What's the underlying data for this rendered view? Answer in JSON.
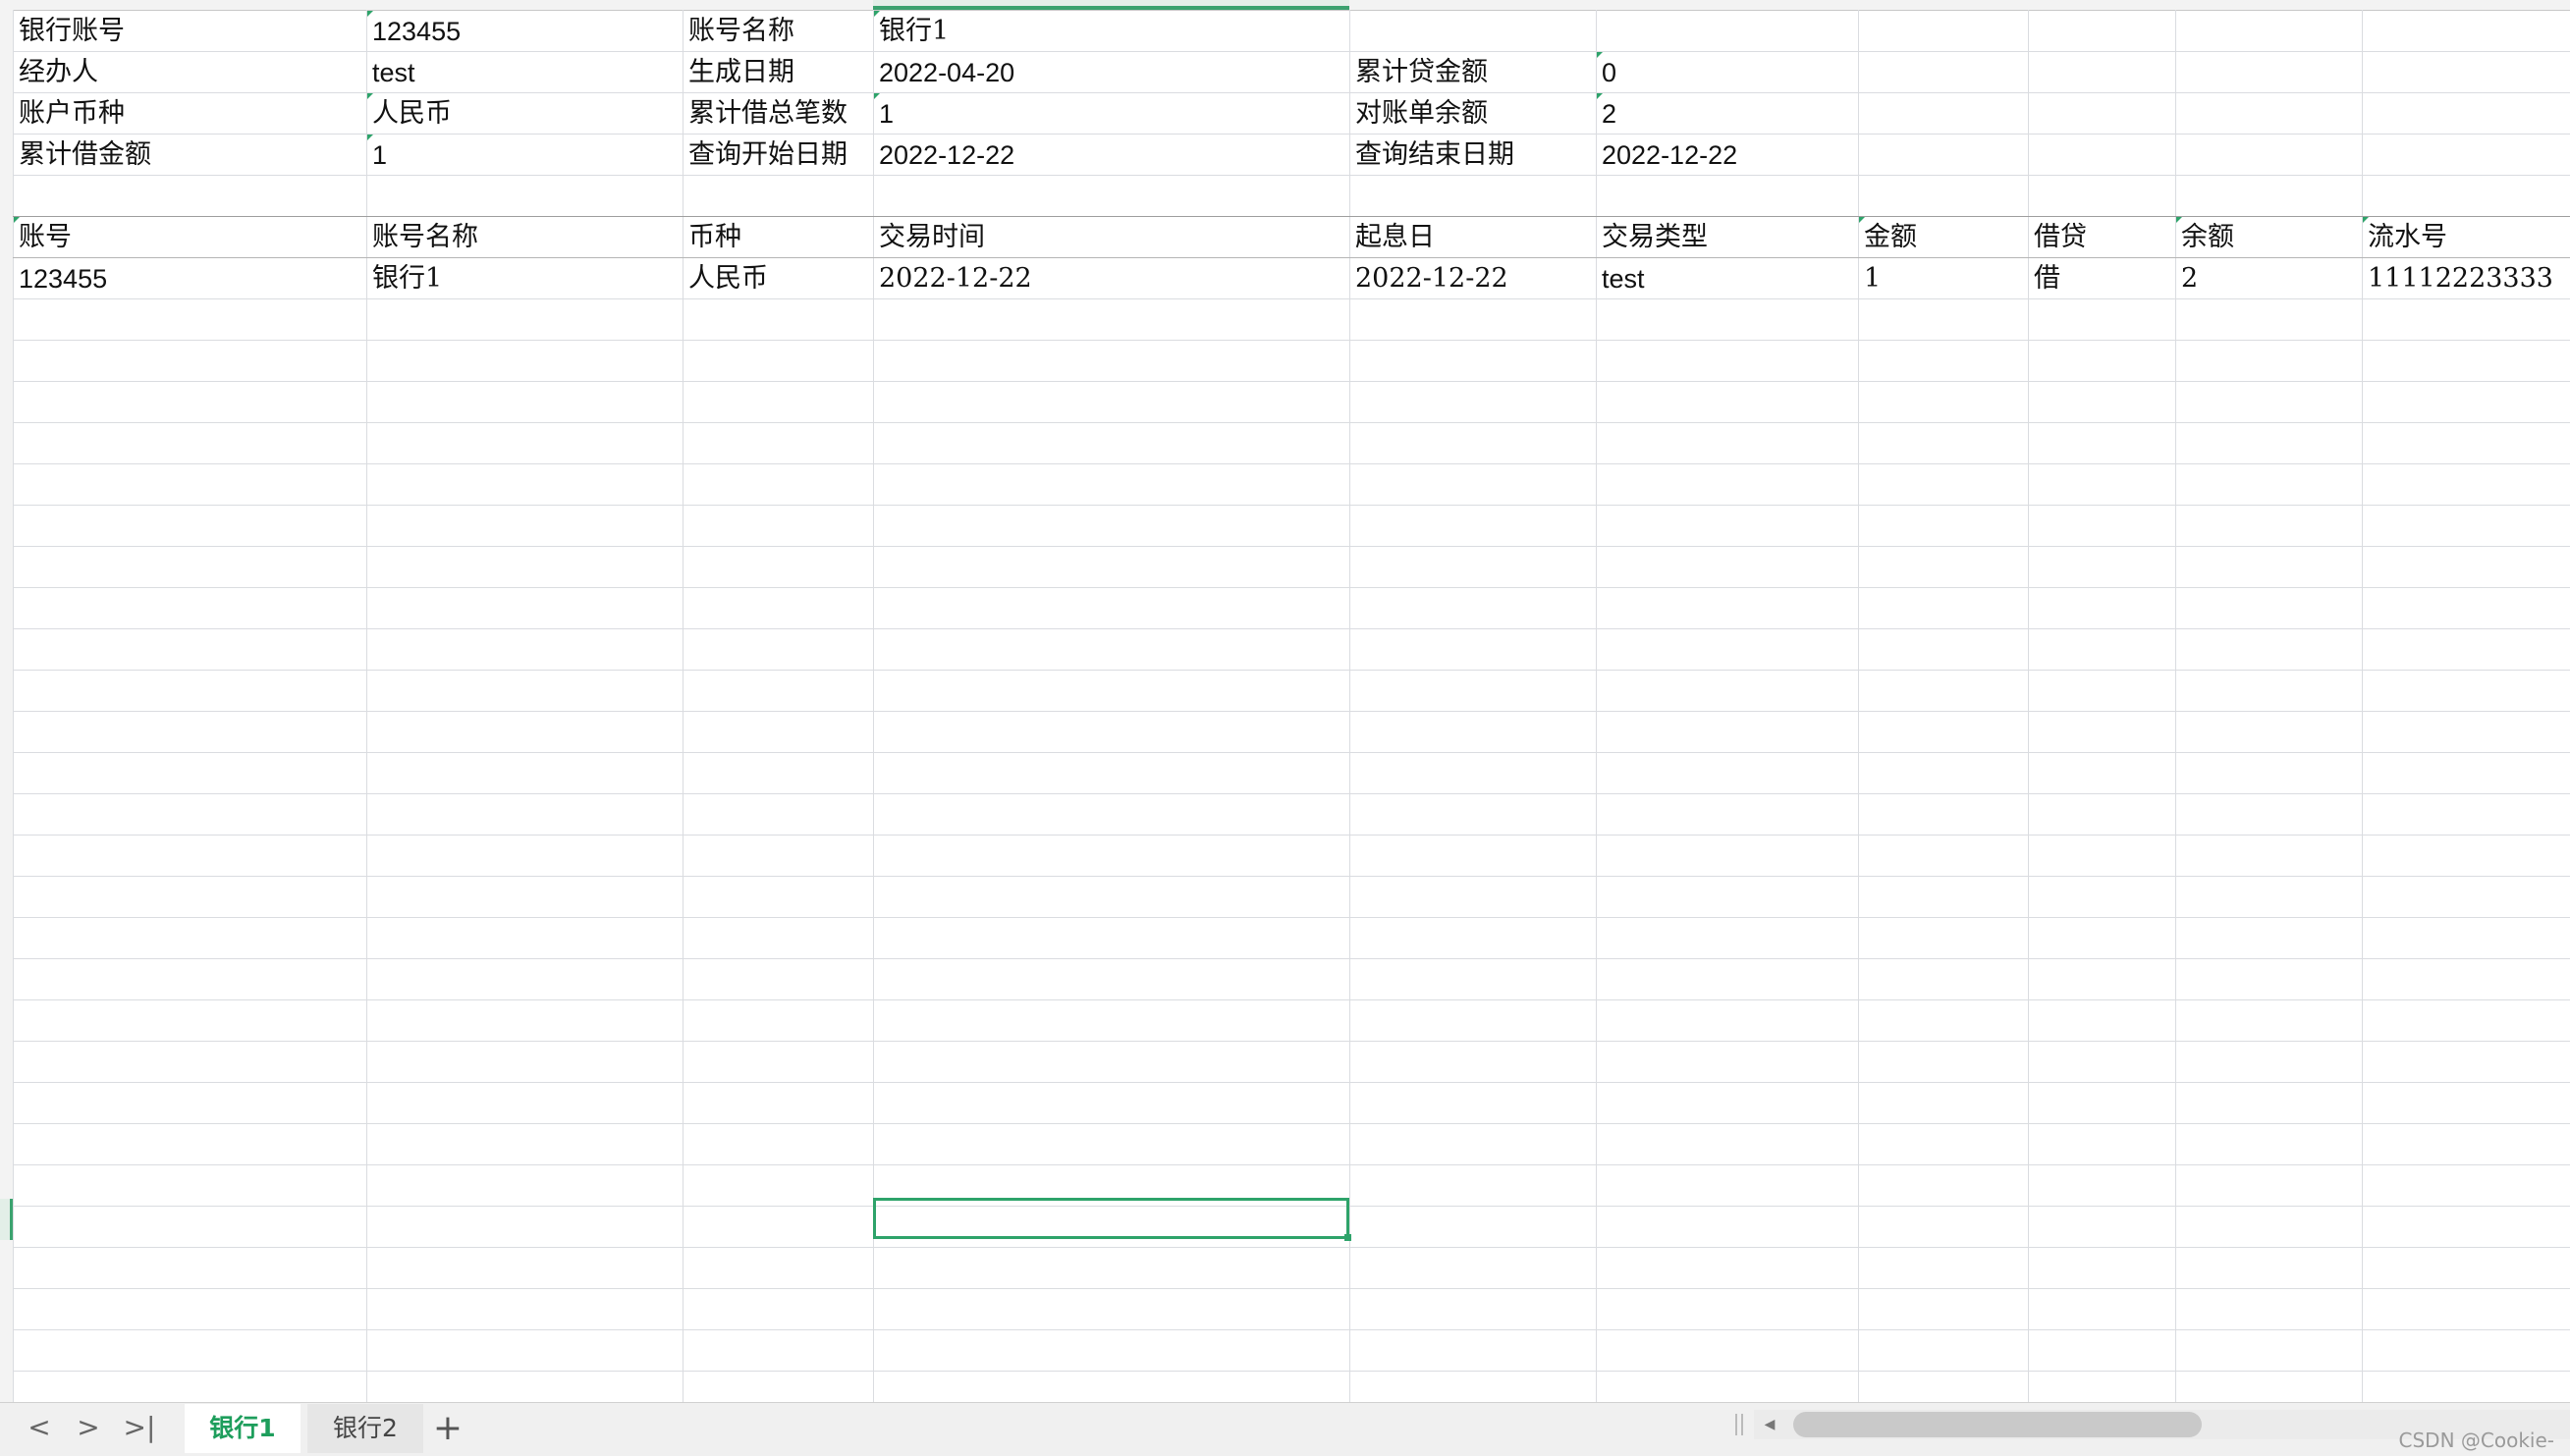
{
  "info_rows": [
    [
      {
        "col": 0,
        "text": "银行账号",
        "font": "serif"
      },
      {
        "col": 1,
        "text": "123455",
        "font": "sans",
        "marker": true
      },
      {
        "col": 2,
        "text": "账号名称",
        "font": "serif"
      },
      {
        "col": 3,
        "text": "银行1",
        "font": "serif",
        "marker": true
      }
    ],
    [
      {
        "col": 0,
        "text": "经办人",
        "font": "serif"
      },
      {
        "col": 1,
        "text": "test",
        "font": "sans"
      },
      {
        "col": 2,
        "text": "生成日期",
        "font": "serif"
      },
      {
        "col": 3,
        "text": "2022-04-20",
        "font": "sans"
      },
      {
        "col": 4,
        "text": "累计贷金额",
        "font": "serif"
      },
      {
        "col": 5,
        "text": "0",
        "font": "sans",
        "marker": true
      }
    ],
    [
      {
        "col": 0,
        "text": "账户币种",
        "font": "serif"
      },
      {
        "col": 1,
        "text": "人民币",
        "font": "serif",
        "marker": true
      },
      {
        "col": 2,
        "text": "累计借总笔数",
        "font": "serif"
      },
      {
        "col": 3,
        "text": "1",
        "font": "sans",
        "marker": true
      },
      {
        "col": 4,
        "text": "对账单余额",
        "font": "serif"
      },
      {
        "col": 5,
        "text": "2",
        "font": "sans",
        "marker": true
      }
    ],
    [
      {
        "col": 0,
        "text": "累计借金额",
        "font": "serif"
      },
      {
        "col": 1,
        "text": "1",
        "font": "sans",
        "marker": true
      },
      {
        "col": 2,
        "text": "查询开始日期",
        "font": "serif"
      },
      {
        "col": 3,
        "text": "2022-12-22",
        "font": "sans"
      },
      {
        "col": 4,
        "text": "查询结束日期",
        "font": "serif"
      },
      {
        "col": 5,
        "text": "2022-12-22",
        "font": "sans"
      }
    ]
  ],
  "table": {
    "headers": [
      "账号",
      "账号名称",
      "币种",
      "交易时间",
      "起息日",
      "交易类型",
      "金额",
      "借贷",
      "余额",
      "流水号"
    ],
    "header_markers": [
      0,
      6,
      8,
      9
    ],
    "rows": [
      {
        "cells": [
          "123455",
          "银行1",
          "人民币",
          "2022-12-22",
          "2022-12-22",
          "test",
          "1",
          "借",
          "2",
          "11112223333"
        ],
        "fonts": [
          "sans",
          "serif",
          "serif",
          "serif",
          "serif",
          "sans",
          "serif",
          "serif",
          "serif",
          "serif"
        ]
      }
    ]
  },
  "sheet_tabs": [
    {
      "label": "银行1",
      "active": true
    },
    {
      "label": "银行2",
      "active": false
    }
  ],
  "nav": {
    "prev": "<",
    "next": ">",
    "last": ">|",
    "add": "+"
  },
  "watermark": "CSDN @Cookie-",
  "colors": {
    "accent": "#2ea36a",
    "gridline": "#dadce0"
  }
}
